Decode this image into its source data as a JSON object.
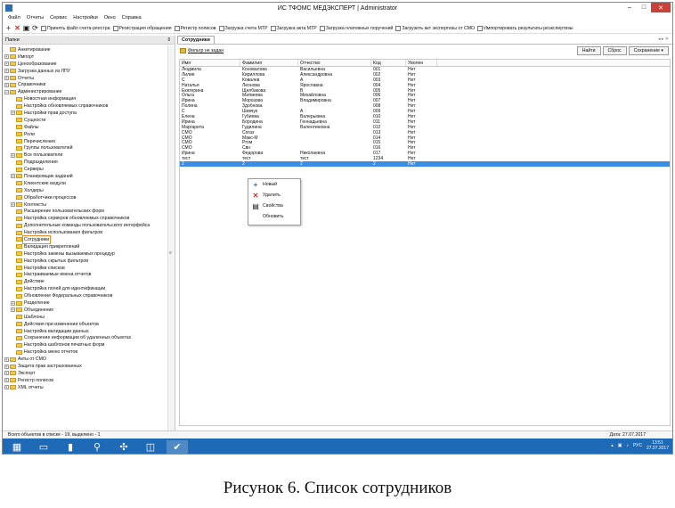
{
  "window": {
    "title": "ИС ТФОМС МЕДЭКСПЕРТ | Administrator",
    "controls": [
      "–",
      "□",
      "✕"
    ]
  },
  "menu": [
    "Файл",
    "Отчеты",
    "Сервис",
    "Настройки",
    "Окно",
    "Справка"
  ],
  "toolbar": [
    "Принять файл счета-реестра",
    "Регистрация обращения",
    "Регистр полисов",
    "Загрузка счета МТР",
    "Загрузка акта МТР",
    "Загрузка платежных поручений",
    "Загрузить акт экспертизы от СМО",
    "Импортировать результаты реэкспертизы"
  ],
  "left_panel": {
    "header": "Папки",
    "pin": "⇕",
    "tree": [
      {
        "label": "Анкетирование",
        "level": 0,
        "exp": ""
      },
      {
        "label": "Импорт",
        "level": 0,
        "exp": "+"
      },
      {
        "label": "Ценообразование",
        "level": 0,
        "exp": "+"
      },
      {
        "label": "Загрузка данных из ЛПУ",
        "level": 0,
        "exp": "+"
      },
      {
        "label": "Отчеты",
        "level": 0,
        "exp": "+"
      },
      {
        "label": "Справочники",
        "level": 0,
        "exp": "+"
      },
      {
        "label": "Администрирование",
        "level": 0,
        "exp": "–"
      },
      {
        "label": "Новостная информация",
        "level": 1,
        "exp": ""
      },
      {
        "label": "Настройка обновляемых справочников",
        "level": 1,
        "exp": ""
      },
      {
        "label": "Настройки прав доступа",
        "level": 1,
        "exp": "+"
      },
      {
        "label": "Сущности",
        "level": 1,
        "exp": ""
      },
      {
        "label": "Файлы",
        "level": 1,
        "exp": ""
      },
      {
        "label": "Роли",
        "level": 1,
        "exp": ""
      },
      {
        "label": "Перечисления",
        "level": 1,
        "exp": ""
      },
      {
        "label": "Группы пользователей",
        "level": 1,
        "exp": ""
      },
      {
        "label": "Все пользователи",
        "level": 1,
        "exp": "+"
      },
      {
        "label": "Подразделения",
        "level": 1,
        "exp": ""
      },
      {
        "label": "Серверы",
        "level": 1,
        "exp": ""
      },
      {
        "label": "Планировщик заданий",
        "level": 1,
        "exp": "+"
      },
      {
        "label": "Клиентские модули",
        "level": 1,
        "exp": ""
      },
      {
        "label": "Холдеры",
        "level": 1,
        "exp": ""
      },
      {
        "label": "Обработчики процессов",
        "level": 1,
        "exp": ""
      },
      {
        "label": "Контексты",
        "level": 1,
        "exp": "+"
      },
      {
        "label": "Расширение пользовательских форм",
        "level": 1,
        "exp": ""
      },
      {
        "label": "Настройка серверов обновляемых справочников",
        "level": 1,
        "exp": ""
      },
      {
        "label": "Дополнительные команды пользовательского интерфейса",
        "level": 1,
        "exp": ""
      },
      {
        "label": "Настройка использования фильтров",
        "level": 1,
        "exp": ""
      },
      {
        "label": "Сотрудники",
        "level": 1,
        "exp": "",
        "selected": true
      },
      {
        "label": "Валидация прикреплений",
        "level": 1,
        "exp": ""
      },
      {
        "label": "Настройка замены вызываемых процедур",
        "level": 1,
        "exp": ""
      },
      {
        "label": "Настройка скрытых фильтров",
        "level": 1,
        "exp": ""
      },
      {
        "label": "Настройки списков",
        "level": 1,
        "exp": ""
      },
      {
        "label": "Настраиваемые имена отчетов",
        "level": 1,
        "exp": ""
      },
      {
        "label": "Действие",
        "level": 1,
        "exp": ""
      },
      {
        "label": "Настройка полей для идентификации",
        "level": 1,
        "exp": ""
      },
      {
        "label": "Обновление Федеральных справочников",
        "level": 1,
        "exp": ""
      },
      {
        "label": "Разделение",
        "level": 1,
        "exp": "+"
      },
      {
        "label": "Объединение",
        "level": 1,
        "exp": "+"
      },
      {
        "label": "Шаблоны",
        "level": 1,
        "exp": ""
      },
      {
        "label": "Действия при изменении объектов",
        "level": 1,
        "exp": ""
      },
      {
        "label": "Настройка валидации данных",
        "level": 1,
        "exp": ""
      },
      {
        "label": "Сохранение информации об удаленных объектах",
        "level": 1,
        "exp": ""
      },
      {
        "label": "Настройка шаблонов печатных форм",
        "level": 1,
        "exp": ""
      },
      {
        "label": "Настройка меню отчетов",
        "level": 1,
        "exp": ""
      },
      {
        "label": "Акты от СМО",
        "level": 0,
        "exp": "+"
      },
      {
        "label": "Защита прав застрахованных",
        "level": 0,
        "exp": "+"
      },
      {
        "label": "Экспорт",
        "level": 0,
        "exp": "+"
      },
      {
        "label": "Регистр полисов",
        "level": 0,
        "exp": "+"
      },
      {
        "label": "XML отчеты",
        "level": 0,
        "exp": "+"
      }
    ]
  },
  "right_panel": {
    "tab": "Сотрудники",
    "tab_nav": "◂ ▸ ✕",
    "filter_label": "Фильтр не задан",
    "buttons": {
      "find": "Найти",
      "reset": "Сброс",
      "save": "Сохранение ▾"
    },
    "columns": [
      "Имя",
      "Фамилия",
      "Отчество",
      "Код",
      "Уволен"
    ],
    "rows": [
      [
        "Людмила",
        "Коновалова",
        "Васильевна",
        "001",
        "Нет"
      ],
      [
        "Лилия",
        "Кириллова",
        "Александровна",
        "002",
        "Нет"
      ],
      [
        "С",
        "Ковалев",
        "А",
        "003",
        "Нет"
      ],
      [
        "Наталья",
        "Леонова",
        "Ярославна",
        "004",
        "Нет"
      ],
      [
        "Екатерина",
        "Щелбакова",
        "В",
        "005",
        "Нет"
      ],
      [
        "Ольга",
        "Матвеева",
        "Михайловна",
        "006",
        "Нет"
      ],
      [
        "Ирина",
        "Морозова",
        "Владимировна",
        "007",
        "Нет"
      ],
      [
        "Полина",
        "Здобнова",
        "",
        "008",
        "Нет"
      ],
      [
        "С",
        "Шевчук",
        "А",
        "009",
        "Нет"
      ],
      [
        "Елена",
        "Губиева",
        "Валерьевна",
        "010",
        "Нет"
      ],
      [
        "Ирина",
        "Бородина",
        "Геннадьевна",
        "011",
        "Нет"
      ],
      [
        "Маргарита",
        "Гудилина",
        "Валентиновна",
        "012",
        "Нет"
      ],
      [
        "СМО",
        "Согаз",
        "",
        "013",
        "Нет"
      ],
      [
        "СМО",
        "Макс-М",
        "",
        "014",
        "Нет"
      ],
      [
        "СМО",
        "Ргом",
        "",
        "015",
        "Нет"
      ],
      [
        "СМО",
        "Свн",
        "",
        "016",
        "Нет"
      ],
      [
        "Ирина",
        "Федорова",
        "Николаевна",
        "017",
        "Нет"
      ],
      [
        "тест",
        "тест",
        "тест",
        "1234",
        "Нет"
      ],
      [
        "2",
        "2",
        "2",
        "2",
        "Нет"
      ]
    ],
    "selected_row": 18
  },
  "context_menu": [
    {
      "label": "Новый",
      "icon": "plus-icon"
    },
    {
      "label": "Удалить",
      "icon": "delete-icon"
    },
    {
      "label": "Свойства",
      "icon": "properties-icon"
    },
    {
      "label": "Обновить",
      "icon": ""
    }
  ],
  "status": {
    "left": "Всего объектов в списке - 19, выделено - 1",
    "date": "Дата: 27.07.2017"
  },
  "taskbar": {
    "lang": "РУС",
    "time": "13:51",
    "date": "27.07.2017"
  },
  "caption": "Рисунок 6. Список сотрудников"
}
